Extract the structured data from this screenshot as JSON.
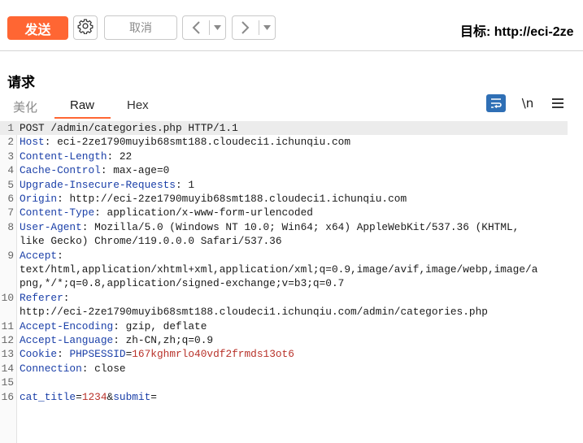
{
  "toolbar": {
    "send_label": "发送",
    "cancel_label": "取消",
    "target_label": "目标: http://eci-2ze",
    "icons": {
      "gear": "gear-icon",
      "back": "chevron-left-icon",
      "forward": "chevron-right-icon",
      "dropdown": "caret-down-icon"
    },
    "accent_color": "#ff6633"
  },
  "request": {
    "title": "请求",
    "tabs": [
      {
        "label": "美化"
      },
      {
        "label": "Raw",
        "active": true
      },
      {
        "label": "Hex"
      }
    ],
    "newline_label": "\\n",
    "icons": {
      "wrap": "text-wrap-icon",
      "menu": "menu-icon"
    }
  },
  "editor": {
    "line_numbers": [
      "1",
      "2",
      "3",
      "4",
      "5",
      "6",
      "7",
      "8",
      "9",
      "10",
      "11",
      "12",
      "13",
      "14",
      "15",
      "16"
    ],
    "lines": [
      {
        "text": "POST /admin/categories.php HTTP/1.1"
      },
      {
        "key": "Host",
        "value": "eci-2ze1790muyib68smt188.cloudeci1.ichunqiu.com"
      },
      {
        "key": "Content-Length",
        "value": "22"
      },
      {
        "key": "Cache-Control",
        "value": "max-age=0"
      },
      {
        "key": "Upgrade-Insecure-Requests",
        "value": "1"
      },
      {
        "key": "Origin",
        "value": "http://eci-2ze1790muyib68smt188.cloudeci1.ichunqiu.com"
      },
      {
        "key": "Content-Type",
        "value": "application/x-www-form-urlencoded"
      },
      {
        "key": "User-Agent",
        "value": "Mozilla/5.0 (Windows NT 10.0; Win64; x64) AppleWebKit/537.36 (KHTML,",
        "cont": "like Gecko) Chrome/119.0.0.0 Safari/537.36"
      },
      {
        "key": "Accept",
        "value": "",
        "cont": "text/html,application/xhtml+xml,application/xml;q=0.9,image/avif,image/webp,image/a",
        "cont2": "png,*/*;q=0.8,application/signed-exchange;v=b3;q=0.7"
      },
      {
        "key": "Referer",
        "value": "",
        "cont": "http://eci-2ze1790muyib68smt188.cloudeci1.ichunqiu.com/admin/categories.php"
      },
      {
        "key": "Accept-Encoding",
        "value": "gzip, deflate"
      },
      {
        "key": "Accept-Language",
        "value": "zh-CN,zh;q=0.9"
      },
      {
        "key": "Cookie",
        "value": "PHPSESSID",
        "cookie_value": "167kghmrlo40vdf2frmds13ot6"
      },
      {
        "key": "Connection",
        "value": "close"
      },
      {
        "text": ""
      },
      {
        "param1": "cat_title",
        "val1": "1234",
        "param2": "submit"
      }
    ]
  }
}
